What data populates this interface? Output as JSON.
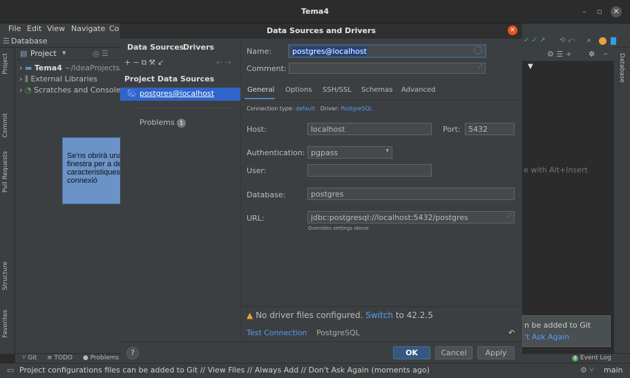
{
  "window": {
    "title": "Tema4"
  },
  "menu": [
    "File",
    "Edit",
    "View",
    "Navigate",
    "Co"
  ],
  "breadcrumb": "Database",
  "project": {
    "header": "Project",
    "items": [
      {
        "name": "Tema4",
        "path": "~/IdeaProjects/"
      },
      {
        "name": "External Libraries"
      },
      {
        "name": "Scratches and Consoles"
      }
    ]
  },
  "left_tabs": [
    "Project",
    "Commit",
    "Pull Requests",
    "Structure",
    "Favorites"
  ],
  "right_tabs": [
    "Database"
  ],
  "editor": {
    "hint": "e with Alt+Insert"
  },
  "notification": {
    "line1": "n be added to Git",
    "line2": "'t Ask Again"
  },
  "bottom_tabs": [
    "Git",
    "TODO",
    "Problems"
  ],
  "event_log": {
    "count": "3",
    "label": "Event Log"
  },
  "status": {
    "message": "Project configurations files can be added to Git // View Files // Always Add // Don't Ask Again (moments ago)",
    "branch": "main"
  },
  "callout": {
    "text": "Se'ns obrirà una nova finestra per a definir les caracteristiques de la connexió"
  },
  "dialog": {
    "title": "Data Sources and Drivers",
    "left_tabs": [
      "Data Sources",
      "Drivers"
    ],
    "section_title": "Project Data Sources",
    "selected_source": "postgres@localhost",
    "problems_label": "Problems",
    "problems_count": "1",
    "name_label": "Name:",
    "name_value": "postgres@localhost",
    "comment_label": "Comment:",
    "subtabs": [
      "General",
      "Options",
      "SSH/SSL",
      "Schemas",
      "Advanced"
    ],
    "conn_type_label": "Connection type:",
    "conn_type_value": "default",
    "driver_label": "Driver:",
    "driver_value": "PostgreSQL",
    "host_label": "Host:",
    "host_value": "localhost",
    "port_label": "Port:",
    "port_value": "5432",
    "auth_label": "Authentication:",
    "auth_value": "pgpass",
    "user_label": "User:",
    "user_value": "",
    "database_label": "Database:",
    "database_value": "postgres",
    "url_label": "URL:",
    "url_value": "jdbc:postgresql://localhost:5432/postgres",
    "url_note": "Overrides settings above",
    "warn_text": "No driver files configured.",
    "warn_link": "Switch",
    "warn_tail": "to 42.2.5",
    "test_connection": "Test Connection",
    "test_driver": "PostgreSQL",
    "ok": "OK",
    "cancel": "Cancel",
    "apply": "Apply",
    "help": "?"
  }
}
